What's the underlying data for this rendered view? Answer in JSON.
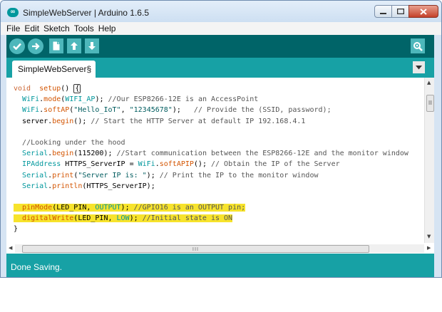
{
  "window": {
    "title": "SimpleWebServer | Arduino 1.6.5"
  },
  "menu": [
    "File",
    "Edit",
    "Sketch",
    "Tools",
    "Help"
  ],
  "toolbar": {
    "buttons": [
      "verify-icon",
      "upload-icon",
      "new-icon",
      "open-icon",
      "save-icon"
    ],
    "serial_monitor": "serial-monitor-icon",
    "accent": "#006468"
  },
  "tabs": [
    {
      "label": "SimpleWebServer§"
    }
  ],
  "editor": {
    "lines": [
      {
        "hl": false,
        "tokens": [
          [
            "kw",
            "void"
          ],
          [
            "",
            "  "
          ],
          [
            "fn",
            "setup"
          ],
          [
            "",
            "() "
          ],
          [
            "cur",
            "{"
          ]
        ]
      },
      {
        "hl": false,
        "tokens": [
          [
            "",
            "  "
          ],
          [
            "ty",
            "WiFi"
          ],
          [
            "",
            "."
          ],
          [
            "fn",
            "mode"
          ],
          [
            "",
            "("
          ],
          [
            "ty",
            "WIFI_AP"
          ],
          [
            "",
            "); "
          ],
          [
            "cm",
            "//Our ESP8266-12E is an AccessPoint"
          ]
        ]
      },
      {
        "hl": false,
        "tokens": [
          [
            "",
            "  "
          ],
          [
            "ty",
            "WiFi"
          ],
          [
            "",
            "."
          ],
          [
            "fn",
            "softAP"
          ],
          [
            "",
            "("
          ],
          [
            "st",
            "\"Hello_IoT\""
          ],
          [
            "",
            ", "
          ],
          [
            "st",
            "\"12345678\""
          ],
          [
            "",
            "); "
          ],
          [
            "cm",
            "  // Provide the (SSID, password);"
          ]
        ]
      },
      {
        "hl": false,
        "tokens": [
          [
            "",
            "  server."
          ],
          [
            "fn",
            "begin"
          ],
          [
            "",
            "(); "
          ],
          [
            "cm",
            "// Start the HTTP Server at default IP 192.168.4.1"
          ]
        ]
      },
      {
        "hl": false,
        "tokens": [
          [
            "",
            ""
          ]
        ]
      },
      {
        "hl": false,
        "tokens": [
          [
            "",
            "  "
          ],
          [
            "cm",
            "//Looking under the hood"
          ]
        ]
      },
      {
        "hl": false,
        "tokens": [
          [
            "",
            "  "
          ],
          [
            "ty",
            "Serial"
          ],
          [
            "",
            "."
          ],
          [
            "fn",
            "begin"
          ],
          [
            "",
            "(115200); "
          ],
          [
            "cm",
            "//Start communication between the ESP8266-12E and the monitor window"
          ]
        ]
      },
      {
        "hl": false,
        "tokens": [
          [
            "",
            "  "
          ],
          [
            "ty",
            "IPAddress"
          ],
          [
            "",
            " HTTPS_ServerIP = "
          ],
          [
            "ty",
            "WiFi"
          ],
          [
            "",
            "."
          ],
          [
            "fn",
            "softAPIP"
          ],
          [
            "",
            "(); "
          ],
          [
            "cm",
            "// Obtain the IP of the Server"
          ]
        ]
      },
      {
        "hl": false,
        "tokens": [
          [
            "",
            "  "
          ],
          [
            "ty",
            "Serial"
          ],
          [
            "",
            "."
          ],
          [
            "fn",
            "print"
          ],
          [
            "",
            "("
          ],
          [
            "st",
            "\"Server IP is: \""
          ],
          [
            "",
            "); "
          ],
          [
            "cm",
            "// Print the IP to the monitor window"
          ]
        ]
      },
      {
        "hl": false,
        "tokens": [
          [
            "",
            "  "
          ],
          [
            "ty",
            "Serial"
          ],
          [
            "",
            "."
          ],
          [
            "fn",
            "println"
          ],
          [
            "",
            "(HTTPS_ServerIP);"
          ]
        ]
      },
      {
        "hl": false,
        "tokens": [
          [
            "",
            ""
          ]
        ]
      },
      {
        "hl": true,
        "tokens": [
          [
            "",
            "  "
          ],
          [
            "fn",
            "pinMode"
          ],
          [
            "",
            "(LED_PIN, "
          ],
          [
            "ty",
            "OUTPUT"
          ],
          [
            "",
            "); "
          ],
          [
            "cm",
            "//GPIO16 is an OUTPUT pin;"
          ]
        ]
      },
      {
        "hl": true,
        "tokens": [
          [
            "",
            "  "
          ],
          [
            "fn",
            "digitalWrite"
          ],
          [
            "",
            "(LED_PIN, "
          ],
          [
            "ty",
            "LOW"
          ],
          [
            "",
            "); "
          ],
          [
            "cm",
            "//Initial state is ON"
          ]
        ]
      },
      {
        "hl": false,
        "tokens": [
          [
            "",
            "}"
          ]
        ]
      }
    ]
  },
  "hscroll": {
    "grip": "III"
  },
  "status": {
    "message": "Done Saving."
  }
}
